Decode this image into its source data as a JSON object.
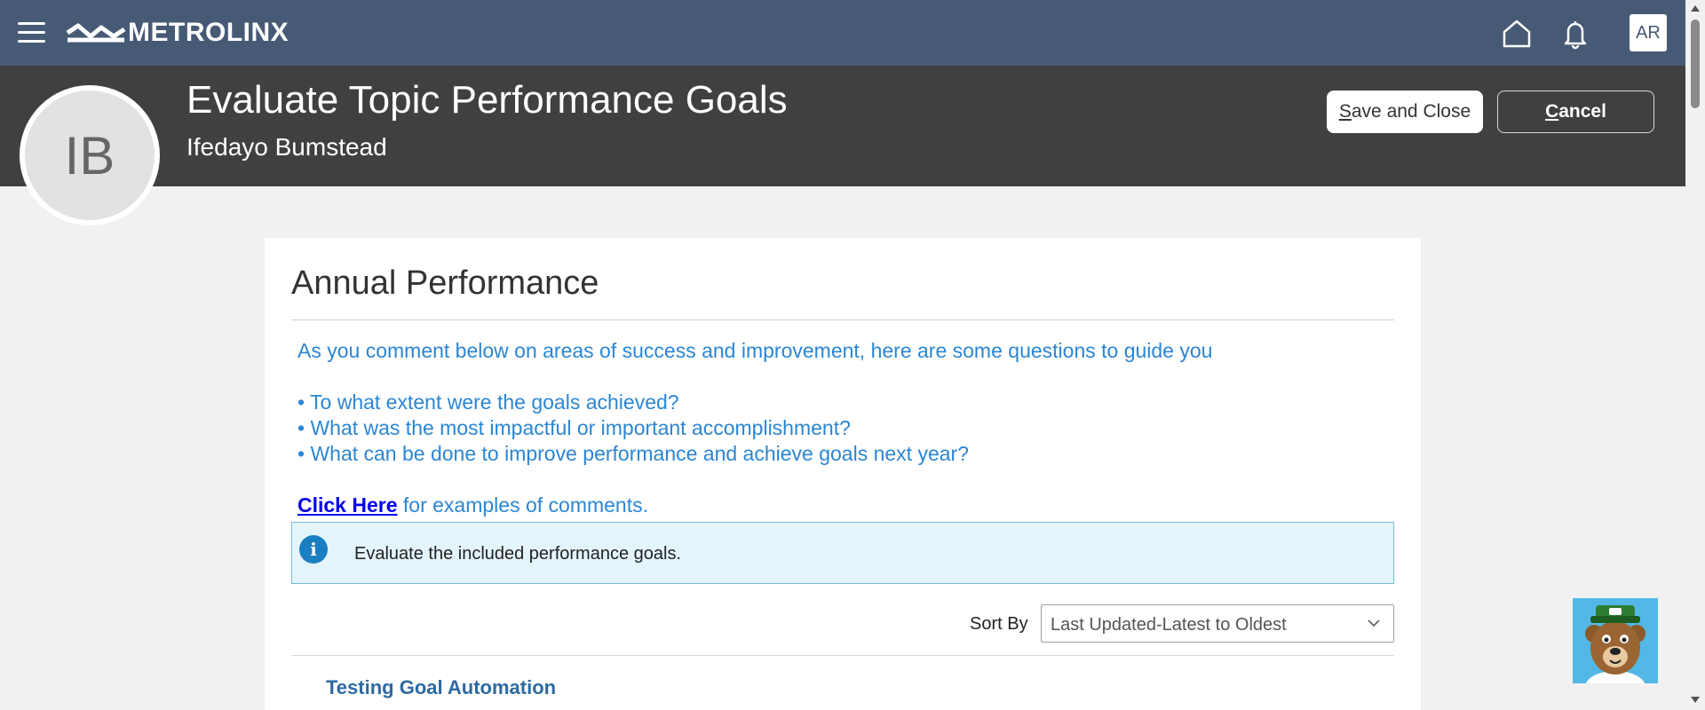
{
  "topbar": {
    "brand": "METROLINX",
    "user_initials": "AR",
    "icons": [
      "hamburger-menu-icon",
      "metrolinx-logo-icon",
      "home-icon",
      "bell-icon"
    ]
  },
  "header": {
    "avatar_initials": "IB",
    "title": "Evaluate Topic Performance Goals",
    "subtitle": "Ifedayo Bumstead",
    "save_label_first": "S",
    "save_label_rest": "ave and Close",
    "cancel_label_first": "C",
    "cancel_label_rest": "ancel"
  },
  "main": {
    "section_title": "Annual Performance",
    "guide_intro": "As you comment below on areas of success and improvement, here are some questions to guide you",
    "guide_bullets": [
      "• To what extent were the goals achieved?",
      "• What was the most impactful or important accomplishment?",
      "• What can be done to improve performance and achieve goals next year?"
    ],
    "click_here": "Click Here",
    "click_here_suffix": " for examples of comments.",
    "info_text": "Evaluate the included performance goals.",
    "sort_label": "Sort By",
    "sort_value": "Last Updated-Latest to Oldest",
    "goal_title": "Testing Goal Automation"
  },
  "colors": {
    "topbar": "#475a75",
    "header": "#404040",
    "guide_text": "#2b86d3",
    "link": "#0000ee",
    "info_bg": "#e3f4fb",
    "goal_title": "#2e6aa0"
  }
}
